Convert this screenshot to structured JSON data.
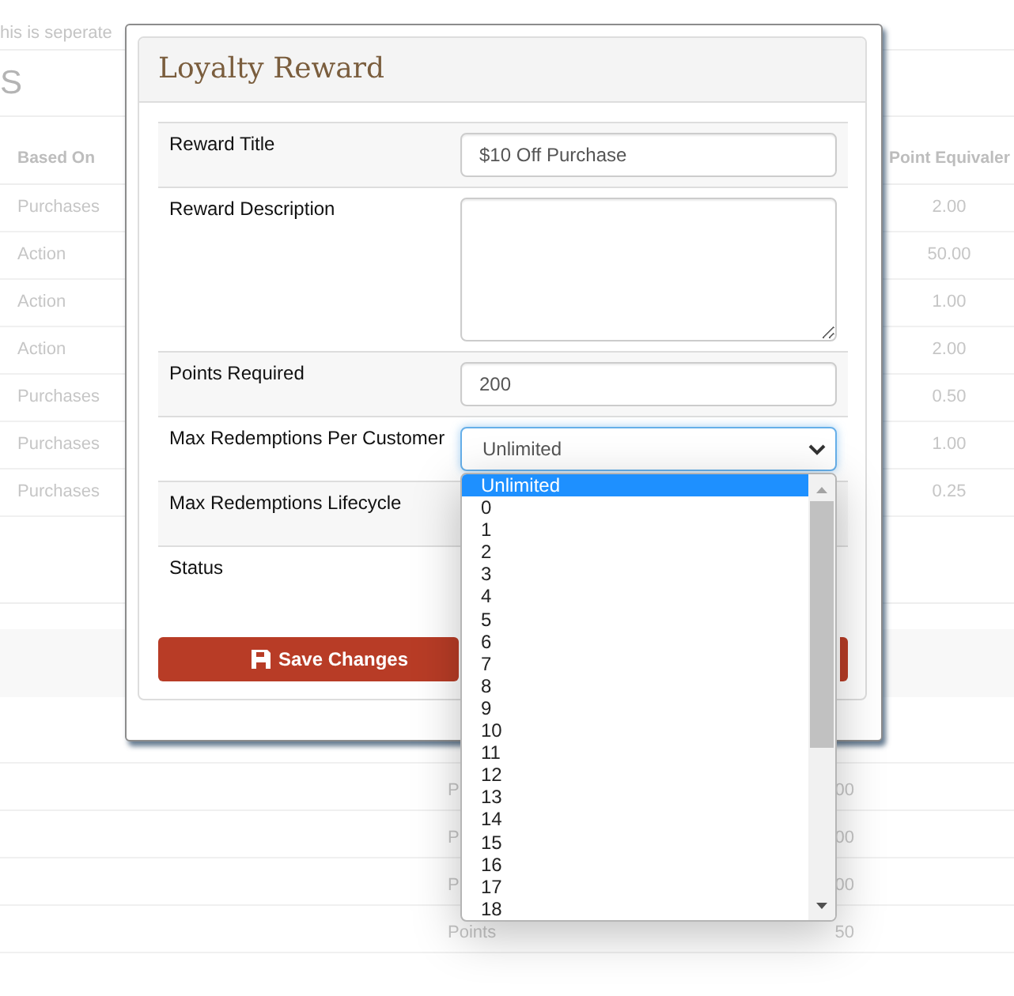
{
  "background_page": {
    "intro_text": "his is seperate",
    "heading": "S",
    "table": {
      "columns": [
        "Based On",
        "Point Equivaler"
      ],
      "rows": [
        {
          "based_on": "Purchases",
          "point_equivalent": "2.00"
        },
        {
          "based_on": "Action",
          "point_equivalent": "50.00"
        },
        {
          "based_on": "Action",
          "point_equivalent": "1.00"
        },
        {
          "based_on": "Action",
          "point_equivalent": "2.00"
        },
        {
          "based_on": "Purchases",
          "point_equivalent": "0.50"
        },
        {
          "based_on": "Purchases",
          "point_equivalent": "1.00"
        },
        {
          "based_on": "Purchases",
          "point_equivalent": "0.25"
        }
      ]
    },
    "lower_table": {
      "rows": [
        {
          "column_1": "P",
          "column_2": "00"
        },
        {
          "column_1": "P",
          "column_2": "00"
        },
        {
          "column_1": "P",
          "column_2": "00"
        },
        {
          "column_1": "Points",
          "column_2": "50"
        }
      ]
    }
  },
  "dialog": {
    "title": "Loyalty Reward",
    "fields": [
      {
        "kind": "text",
        "label": "Reward Title",
        "value": "$10 Off Purchase"
      },
      {
        "kind": "textarea",
        "label": "Reward Description"
      },
      {
        "kind": "text",
        "label": "Points Required",
        "value": "200"
      },
      {
        "kind": "select",
        "label": "Max Redemptions Per Customer",
        "value": "Unlimited",
        "expanded": true,
        "options": [
          {
            "label": "Unlimited",
            "selected": true
          },
          {
            "label": "0",
            "selected": false
          },
          {
            "label": "1",
            "selected": false
          },
          {
            "label": "2",
            "selected": false
          },
          {
            "label": "3",
            "selected": false
          },
          {
            "label": "4",
            "selected": false
          },
          {
            "label": "5",
            "selected": false
          },
          {
            "label": "6",
            "selected": false
          },
          {
            "label": "7",
            "selected": false
          },
          {
            "label": "8",
            "selected": false
          },
          {
            "label": "9",
            "selected": false
          },
          {
            "label": "10",
            "selected": false
          },
          {
            "label": "11",
            "selected": false
          },
          {
            "label": "12",
            "selected": false
          },
          {
            "label": "13",
            "selected": false
          },
          {
            "label": "14",
            "selected": false
          },
          {
            "label": "15",
            "selected": false
          },
          {
            "label": "16",
            "selected": false
          },
          {
            "label": "17",
            "selected": false
          },
          {
            "label": "18",
            "selected": false
          }
        ]
      },
      {
        "kind": "covered",
        "label": "Max Redemptions Lifecycle"
      },
      {
        "kind": "covered",
        "label": "Status"
      }
    ],
    "buttons": [
      {
        "kind": "save",
        "label": "Save Changes"
      },
      {
        "kind": "plain"
      }
    ]
  }
}
